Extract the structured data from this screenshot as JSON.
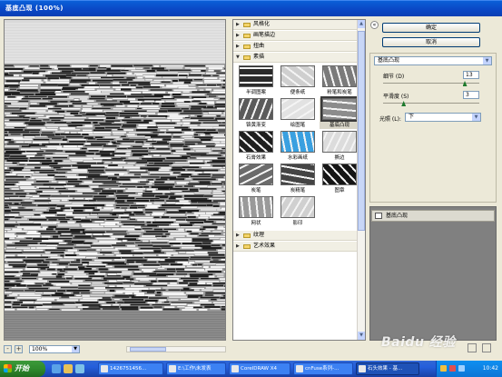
{
  "window": {
    "title": "基底凸现 (100%)"
  },
  "preview": {
    "zoom_value": "100%",
    "zoom_out": "-",
    "zoom_in": "+"
  },
  "gallery": {
    "categories_top": [
      {
        "label": "风格化",
        "expanded": false
      },
      {
        "label": "画笔描边",
        "expanded": false
      },
      {
        "label": "扭曲",
        "expanded": false
      },
      {
        "label": "素描",
        "expanded": true
      }
    ],
    "filters": [
      {
        "label": "半调图案",
        "selected": false
      },
      {
        "label": "便条纸",
        "selected": false
      },
      {
        "label": "粉笔和炭笔",
        "selected": false
      },
      {
        "label": "铬黄渐变",
        "selected": false
      },
      {
        "label": "绘图笔",
        "selected": false
      },
      {
        "label": "基底凸现",
        "selected": true
      },
      {
        "label": "石膏效果",
        "selected": false
      },
      {
        "label": "水彩画纸",
        "selected": false
      },
      {
        "label": "撕边",
        "selected": false
      },
      {
        "label": "炭笔",
        "selected": false
      },
      {
        "label": "炭精笔",
        "selected": false
      },
      {
        "label": "图章",
        "selected": false
      },
      {
        "label": "网状",
        "selected": false
      },
      {
        "label": "影印",
        "selected": false
      }
    ],
    "categories_bottom": [
      {
        "label": "纹理",
        "expanded": false
      },
      {
        "label": "艺术效果",
        "expanded": false
      }
    ]
  },
  "actions": {
    "ok": "确定",
    "cancel": "取消"
  },
  "settings": {
    "filter_select": "基底凸现",
    "detail": {
      "label": "细节 (D)",
      "value": "13",
      "max": 15
    },
    "smoothness": {
      "label": "平滑度 (S)",
      "value": "3",
      "max": 15
    },
    "light": {
      "label": "光照 (L):",
      "value": "下"
    }
  },
  "layers": {
    "items": [
      {
        "label": "基底凸现"
      }
    ]
  },
  "taskbar": {
    "start": "开始",
    "tasks": [
      {
        "label": "1426751456..."
      },
      {
        "label": "E:\\工作\\未发表"
      },
      {
        "label": "CorelDRAW X4"
      },
      {
        "label": "cnFuse系列-..."
      },
      {
        "label": "石头效果 - 基..."
      }
    ],
    "clock": "10:42"
  },
  "watermark": "Baidu 经验"
}
